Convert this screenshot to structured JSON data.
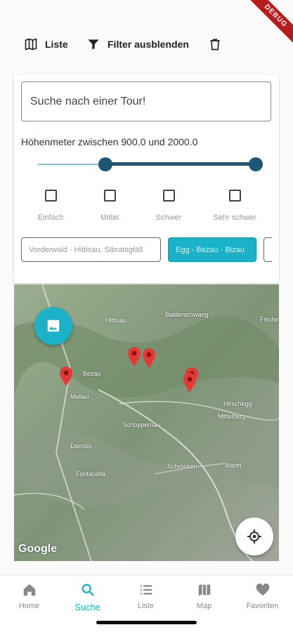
{
  "status": {
    "debug": "DEBUG"
  },
  "toolbar": {
    "list_label": "Liste",
    "filter_label": "Filter ausblenden"
  },
  "filter": {
    "search_placeholder": "Suche nach einer Tour!",
    "range_label": "Höhenmeter zwischen 900.0 und 2000.0",
    "slider_min_fraction": 0.31,
    "slider_max_fraction": 1.0,
    "difficulties": [
      "Einfach",
      "Mittel",
      "Schwer",
      "Sehr schwer"
    ],
    "regions": [
      "Vorderwald - Hittisau, Sibratsgfäll",
      "Egg - Bezau - Bizau",
      ""
    ]
  },
  "map": {
    "labels": [
      "Hittisau",
      "Balderschwang",
      "Fischen",
      "Bezau",
      "Mellau",
      "Schoppernau",
      "Damüls",
      "Schröcken",
      "Warth",
      "Hirschegg",
      "Mittelberg",
      "Fontanella"
    ],
    "attribution": "Google"
  },
  "nav": {
    "items": [
      "Home",
      "Suche",
      "Liste",
      "Map",
      "Favoriten"
    ],
    "active": "Suche"
  },
  "colors": {
    "accent": "#1bb1c8",
    "slider": "#1f5675"
  }
}
